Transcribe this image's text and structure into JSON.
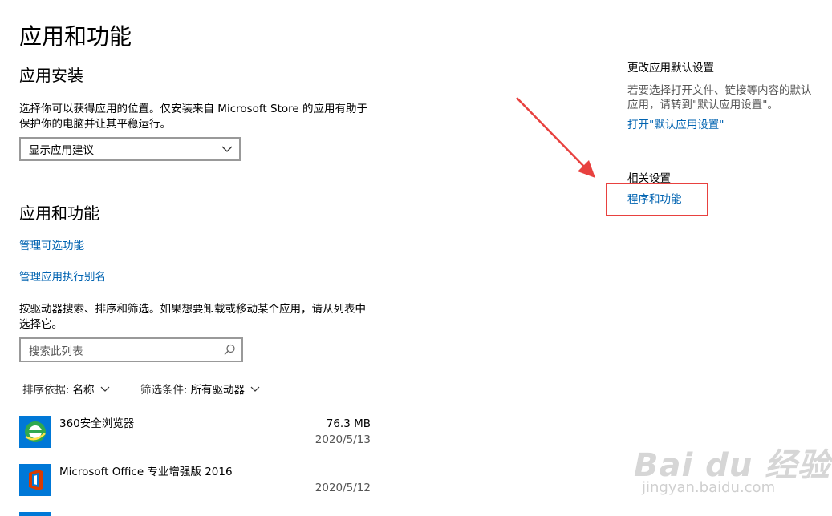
{
  "page": {
    "title": "应用和功能"
  },
  "install": {
    "heading": "应用安装",
    "description_line1": "选择你可以获得应用的位置。仅安装来自 Microsoft Store 的应用有助于",
    "description_line2": "保护你的电脑并让其平稳运行。",
    "dropdown_value": "显示应用建议"
  },
  "apps": {
    "heading": "应用和功能",
    "manage_optional": "管理可选功能",
    "manage_aliases": "管理应用执行别名",
    "help_line1": "按驱动器搜索、排序和筛选。如果想要卸载或移动某个应用，请从列表中",
    "help_line2": "选择它。",
    "search_placeholder": "搜索此列表",
    "sort_label": "排序依据:",
    "sort_value": "名称",
    "filter_label": "筛选条件:",
    "filter_value": "所有驱动器",
    "list": [
      {
        "name": "360安全浏览器",
        "size": "76.3 MB",
        "date": "2020/5/13",
        "icon": "browser-360-icon",
        "color": "#1a8a3c"
      },
      {
        "name": "Microsoft Office 专业增强版 2016",
        "size": "",
        "date": "2020/5/12",
        "icon": "office-icon",
        "color": "#d83b01"
      }
    ]
  },
  "sidebar": {
    "default_heading": "更改应用默认设置",
    "default_desc_line1": "若要选择打开文件、链接等内容的默认",
    "default_desc_line2": "应用，请转到\"默认应用设置\"。",
    "default_link": "打开\"默认应用设置\"",
    "related_heading": "相关设置",
    "related_link": "程序和功能"
  },
  "watermark": {
    "brand": "Bai du 经验",
    "url": "jingyan.baidu.com"
  },
  "colors": {
    "link": "#0063b1",
    "annotation": "#e8413f"
  }
}
